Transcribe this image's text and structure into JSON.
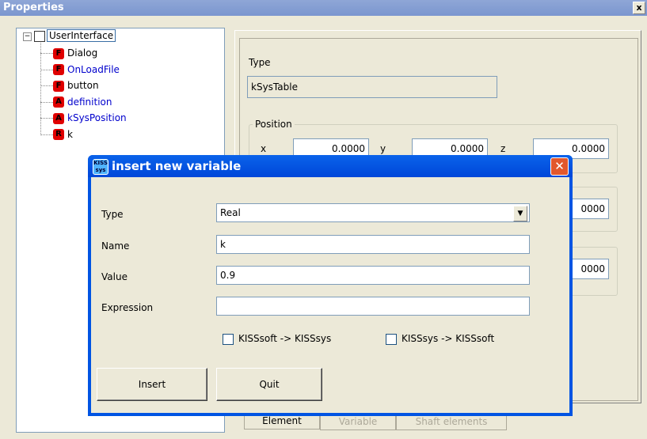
{
  "window": {
    "title": "Properties",
    "close": "x"
  },
  "tree": {
    "root": "UserInterface",
    "items": [
      {
        "badge": "F",
        "label": "Dialog",
        "color": "#000000"
      },
      {
        "badge": "F",
        "label": "OnLoadFile",
        "color": "#0000cc"
      },
      {
        "badge": "F",
        "label": "button",
        "color": "#000000"
      },
      {
        "badge": "A",
        "label": "definition",
        "color": "#0000cc"
      },
      {
        "badge": "A",
        "label": "kSysPosition",
        "color": "#0000cc"
      },
      {
        "badge": "R",
        "label": "k",
        "color": "#000000"
      }
    ]
  },
  "props": {
    "type_label": "Type",
    "type_value": "kSysTable",
    "position_label": "Position",
    "x_label": "x",
    "x_value": "0.0000",
    "y_label": "y",
    "y_value": "0.0000",
    "z_label": "z",
    "z_value": "0.0000",
    "row2_value": "0000",
    "row3_value": "0000"
  },
  "tabs": [
    {
      "label": "Element",
      "active": true
    },
    {
      "label": "Variable",
      "active": false
    },
    {
      "label": "Shaft elements",
      "active": false
    }
  ],
  "dialog": {
    "title": "insert new variable",
    "icon_text": "KISS sys",
    "type_label": "Type",
    "type_value": "Real",
    "name_label": "Name",
    "name_value": "k",
    "value_label": "Value",
    "value_value": "0.9",
    "expression_label": "Expression",
    "expression_value": "",
    "chk1": "KISSsoft -> KISSsys",
    "chk2": "KISSsys -> KISSsoft",
    "insert": "Insert",
    "quit": "Quit",
    "close": "✕"
  },
  "colors": {
    "titlebar": "#0054e3",
    "close": "#e2572c",
    "badge": "#e00000"
  }
}
